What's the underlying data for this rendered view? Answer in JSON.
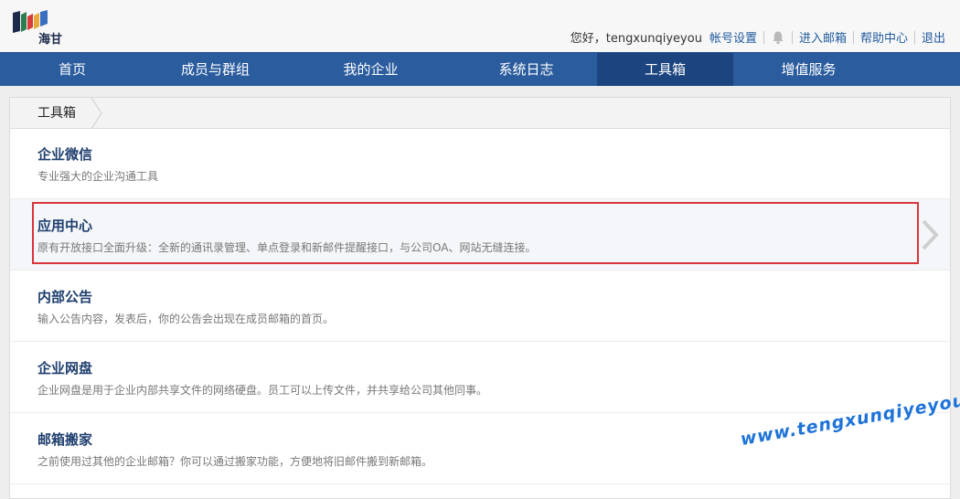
{
  "header": {
    "logo_text": "海甘",
    "greeting": "您好，tengxunqiyeyou",
    "links": {
      "account_settings": "帐号设置",
      "enter_mailbox": "进入邮箱",
      "help_center": "帮助中心",
      "logout": "退出"
    }
  },
  "nav": {
    "items": [
      {
        "label": "首页"
      },
      {
        "label": "成员与群组"
      },
      {
        "label": "我的企业"
      },
      {
        "label": "系统日志"
      },
      {
        "label": "工具箱"
      },
      {
        "label": "增值服务"
      }
    ],
    "active": "工具箱"
  },
  "breadcrumb": {
    "label": "工具箱"
  },
  "tools": [
    {
      "title": "企业微信",
      "desc": "专业强大的企业沟通工具"
    },
    {
      "title": "应用中心",
      "desc": "原有开放接口全面升级：全新的通讯录管理、单点登录和新邮件提醒接口，与公司OA、网站无缝连接。"
    },
    {
      "title": "内部公告",
      "desc": "输入公告内容，发表后，你的公告会出现在成员邮箱的首页。"
    },
    {
      "title": "企业网盘",
      "desc": "企业网盘是用于企业内部共享文件的网络硬盘。员工可以上传文件，并共享给公司其他同事。"
    },
    {
      "title": "邮箱搬家",
      "desc": "之前使用过其他的企业邮箱？你可以通过搬家功能，方便地将旧邮件搬到新邮箱。"
    }
  ],
  "highlight_color": "#d9343a",
  "nav_color": "#2b5c9e",
  "watermark": "www.tengxunqiyeyou.com"
}
